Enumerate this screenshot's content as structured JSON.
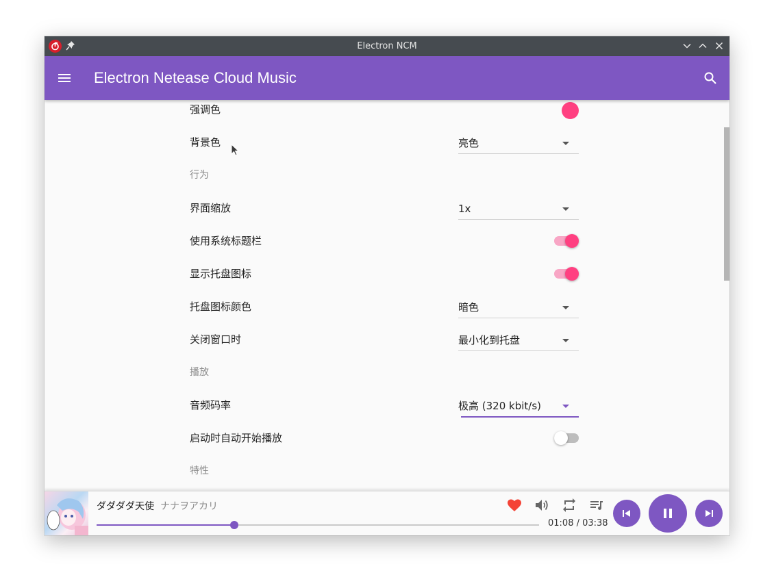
{
  "window": {
    "title": "Electron NCM"
  },
  "appbar": {
    "title": "Electron Netease Cloud Music"
  },
  "colors": {
    "primary": "#7e57c2",
    "accent": "#ff4081",
    "titlebar": "#464b50"
  },
  "settings": {
    "accent_color": {
      "label": "强调色",
      "value": "#ff4081"
    },
    "background": {
      "label": "背景色",
      "value": "亮色"
    },
    "section_behavior": "行为",
    "zoom": {
      "label": "界面缩放",
      "value": "1x"
    },
    "system_titlebar": {
      "label": "使用系统标题栏",
      "on": true
    },
    "tray_icon": {
      "label": "显示托盘图标",
      "on": true
    },
    "tray_color": {
      "label": "托盘图标颜色",
      "value": "暗色"
    },
    "on_close": {
      "label": "关闭窗口时",
      "value": "最小化到托盘"
    },
    "section_playback": "播放",
    "bitrate": {
      "label": "音频码率",
      "value": "极高 (320 kbit/s)"
    },
    "autoplay": {
      "label": "启动时自动开始播放",
      "on": false
    },
    "section_features": "特性"
  },
  "player": {
    "song": "ダダダダ天使",
    "artist": "ナナヲアカリ",
    "time": "01:08 / 03:38",
    "progress": 0.311,
    "favorited": true,
    "icons": [
      "heart-icon",
      "volume-icon",
      "repeat-icon",
      "playlist-icon",
      "previous-icon",
      "pause-icon",
      "next-icon"
    ]
  }
}
